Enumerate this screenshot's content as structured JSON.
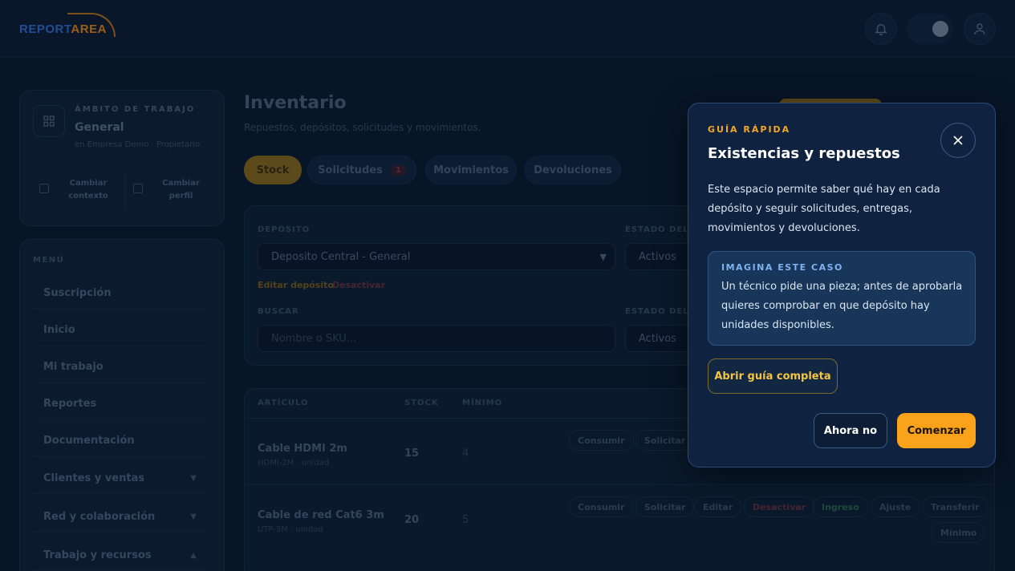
{
  "header": {
    "logo_part1": "REPORT",
    "logo_part2": "AREA",
    "icons": {
      "notifications": "bell-icon",
      "theme": "theme-toggle",
      "account": "user-icon"
    }
  },
  "sidebar": {
    "scope": {
      "label": "ÁMBITO DE TRABAJO",
      "name": "General",
      "sub": "en Empresa Demo · Propietario",
      "change_context_line1": "Cambiar",
      "change_context_line2": "contexto",
      "change_profile_line1": "Cambiar",
      "change_profile_line2": "perfil"
    },
    "menu_label": "MENÚ",
    "items": [
      {
        "label": "Suscripción"
      },
      {
        "label": "Inicio"
      },
      {
        "label": "Mi trabajo"
      },
      {
        "label": "Reportes"
      },
      {
        "label": "Documentación"
      },
      {
        "label": "Clientes y ventas"
      },
      {
        "label": "Red y colaboración"
      },
      {
        "label": "Trabajo y recursos"
      }
    ]
  },
  "main": {
    "title": "Inventario",
    "subtitle": "Repuestos, depósitos, solicitudes y movimientos.",
    "tabs": [
      {
        "label": "Stock"
      },
      {
        "label": "Solicitudes",
        "badge": "1"
      },
      {
        "label": "Movimientos"
      },
      {
        "label": "Devoluciones"
      }
    ],
    "filters": {
      "deposit_label": "DEPÓSITO",
      "deposit_value": "Deposito Central - General",
      "edit_deposit": "Editar depósito",
      "deactivate": "Desactivar",
      "state_label_1": "ESTADO DEL",
      "state_value_1": "Activos",
      "search_label": "BUSCAR",
      "search_placeholder": "Nombre o SKU...",
      "state_label_2": "ESTADO DEL",
      "state_value_2": "Activos"
    },
    "table": {
      "headers": {
        "article": "ARTÍCULO",
        "stock": "STOCK",
        "minimum": "MÍNIMO"
      },
      "rows": [
        {
          "name": "Cable HDMI 2m",
          "sku": "HDMI-2M · unidad",
          "stock": "15",
          "minimum": "4"
        },
        {
          "name": "Cable de red Cat6 3m",
          "sku": "UTP-3M · unidad",
          "stock": "20",
          "minimum": "5"
        }
      ],
      "actions": {
        "consume": "Consumir",
        "request": "Solicitar",
        "edit": "Editar",
        "deactivate": "Desactivar",
        "income": "Ingreso",
        "adjust": "Ajuste",
        "transfer": "Transferir",
        "minimum": "Mínimo"
      }
    }
  },
  "popover": {
    "kicker": "GUÍA RÁPIDA",
    "title": "Existencias y repuestos",
    "body": "Este espacio permite saber qué hay en cada depósito y seguir solicitudes, entregas, movimientos y devoluciones.",
    "case_kicker": "IMAGINA ESTE CASO",
    "case_text": "Un técnico pide una pieza; antes de aprobarla quieres comprobar en que depósito hay unidades disponibles.",
    "open_guide": "Abrir guía completa",
    "not_now": "Ahora no",
    "start": "Comenzar"
  }
}
